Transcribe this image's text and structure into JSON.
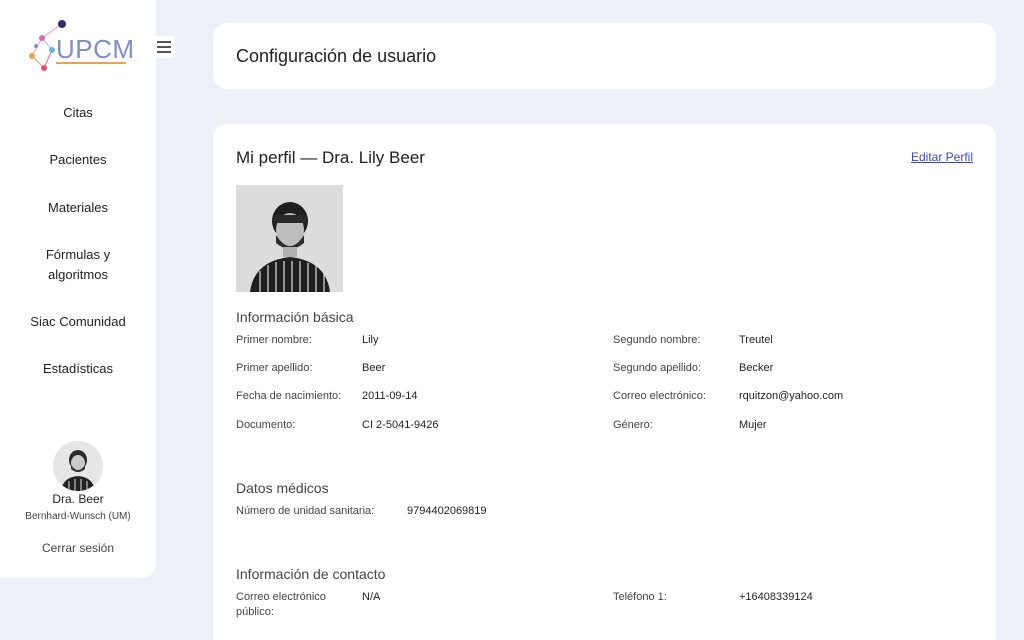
{
  "sidebar": {
    "logo_text": "UPCM",
    "items": [
      {
        "label": "Citas"
      },
      {
        "label": "Pacientes"
      },
      {
        "label": "Materiales"
      },
      {
        "label": "Fórmulas y algoritmos"
      },
      {
        "label": "Siac Comunidad"
      },
      {
        "label": "Estadísticas"
      }
    ],
    "user": {
      "name": "Dra. Beer",
      "org": "Bernhard-Wunsch (UM)",
      "logout_label": "Cerrar sesión"
    }
  },
  "header": {
    "title": "Configuración de usuario"
  },
  "profile": {
    "title": "Mi perfil — Dra. Lily Beer",
    "edit_label": "Editar Perfil",
    "basic": {
      "title": "Información básica",
      "first_name_label": "Primer nombre:",
      "first_name": "Lily",
      "middle_name_label": "Segundo nombre:",
      "middle_name": "Treutel",
      "last_name_label": "Primer apellido:",
      "last_name": "Beer",
      "second_last_name_label": "Segundo apellido:",
      "second_last_name": "Becker",
      "dob_label": "Fecha de nacimiento:",
      "dob": "2011-09-14",
      "email_label": "Correo electrónico:",
      "email": "rquitzon@yahoo.com",
      "document_label": "Documento:",
      "document": "CI 2-5041-9426",
      "gender_label": "Género:",
      "gender": "Mujer"
    },
    "medical": {
      "title": "Datos médicos",
      "unit_label": "Número de unidad sanitaria:",
      "unit": "9794402069819"
    },
    "contact": {
      "title": "Información de contacto",
      "public_email_label": "Correo electrónico público:",
      "public_email": "N/A",
      "phone1_label": "Teléfono 1:",
      "phone1": "+16408339124"
    }
  },
  "colors": {
    "background": "#eef0f8",
    "link": "#3a46d8"
  }
}
